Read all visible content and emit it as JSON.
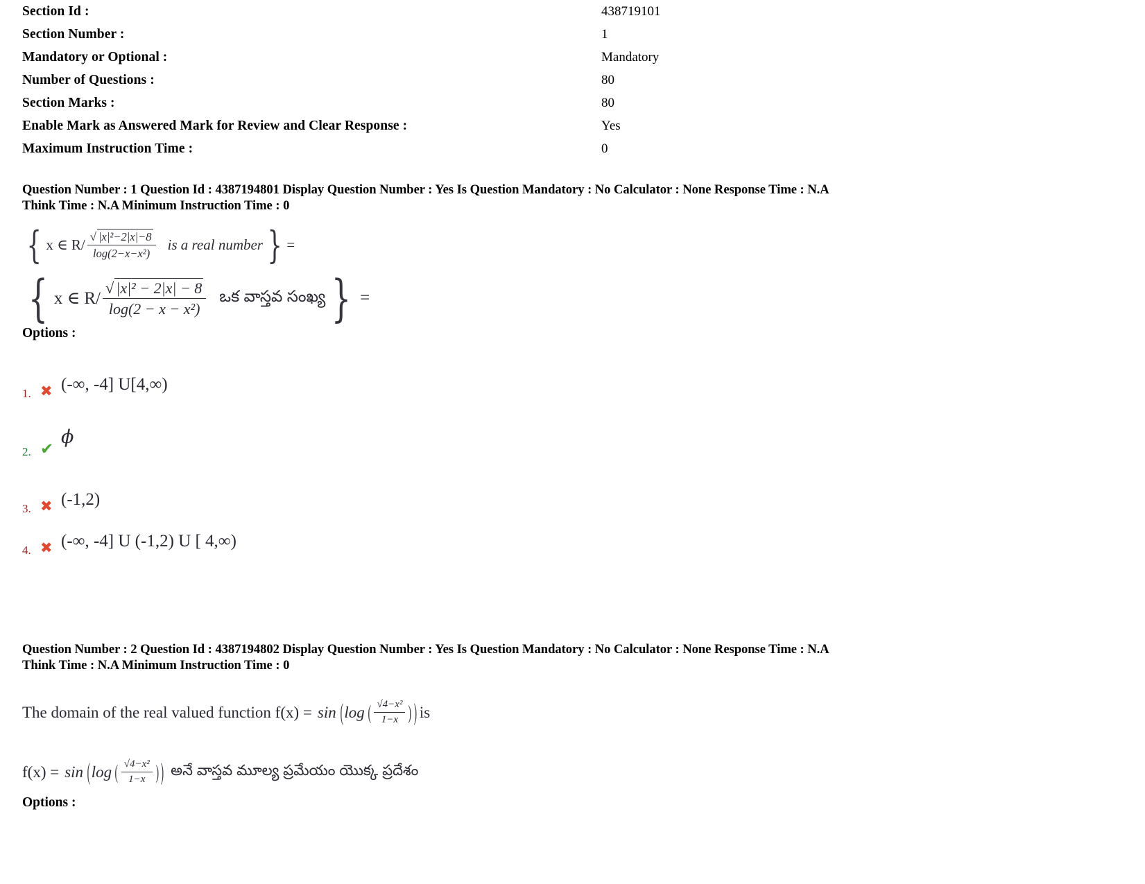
{
  "section": {
    "rows": [
      {
        "label": "Section Id :",
        "value": "438719101"
      },
      {
        "label": "Section Number :",
        "value": "1"
      },
      {
        "label": "Mandatory or Optional :",
        "value": "Mandatory"
      },
      {
        "label": "Number of Questions :",
        "value": "80"
      },
      {
        "label": "Section Marks :",
        "value": "80"
      },
      {
        "label": "Enable Mark as Answered Mark for Review and Clear Response :",
        "value": "Yes"
      },
      {
        "label": "Maximum Instruction Time :",
        "value": "0"
      }
    ]
  },
  "questions": [
    {
      "header_line1": "Question Number : 1 Question Id : 4387194801 Display Question Number : Yes Is Question Mandatory : No Calculator : None Response Time : N.A",
      "header_line2": "Think Time : N.A Minimum Instruction Time : 0",
      "options_label": "Options :",
      "stem_en": {
        "set_open": "{",
        "prefix": "x ∈ R/",
        "numerator": "|x|²−2|x|−8",
        "denominator": "log(2−x−x²)",
        "qualifier": "is a real number",
        "set_close": "}",
        "equals": "="
      },
      "stem_te": {
        "set_open": "{",
        "prefix": "x ∈ R/",
        "numerator": "|x|² − 2|x| − 8",
        "denominator": "log(2 − x − x²)",
        "qualifier": "ఒక వాస్తవ సంఖ్య",
        "set_close": "}",
        "equals": "="
      },
      "options": [
        {
          "number": "1.",
          "mark": "✖",
          "status": "wrong",
          "text": "(-∞, -4] U[4,∞)"
        },
        {
          "number": "2.",
          "mark": "✔",
          "status": "correct",
          "text": "ϕ"
        },
        {
          "number": "3.",
          "mark": "✖",
          "status": "wrong",
          "text": "(-1,2)"
        },
        {
          "number": "4.",
          "mark": "✖",
          "status": "wrong",
          "text": "(-∞, -4] U (-1,2) U [ 4,∞)"
        }
      ]
    },
    {
      "header_line1": "Question Number : 2 Question Id : 4387194802 Display Question Number : Yes Is Question Mandatory : No Calculator : None Response Time : N.A",
      "header_line2": "Think Time : N.A Minimum Instruction Time : 0",
      "options_label": "Options :",
      "stem_en": {
        "lead": "The domain of the real valued function f(x) =",
        "fn": "sin",
        "inner_fn": "log",
        "numerator": "√4−x²",
        "denominator": "1−x",
        "trail": "is"
      },
      "stem_te": {
        "lead": "f(x) =",
        "fn": "sin",
        "inner_fn": "log",
        "numerator": "√4−x²",
        "denominator": "1−x",
        "trail": "అనే వాస్తవ మూల్య ప్రమేయం యొక్క ప్రదేశం"
      },
      "options": []
    }
  ],
  "colors": {
    "wrong_mark": "#e0482f",
    "correct_mark": "#4aa832",
    "option_number_wrong": "#9a1f1f",
    "option_number_correct": "#1d7a2e",
    "text": "#000000"
  }
}
